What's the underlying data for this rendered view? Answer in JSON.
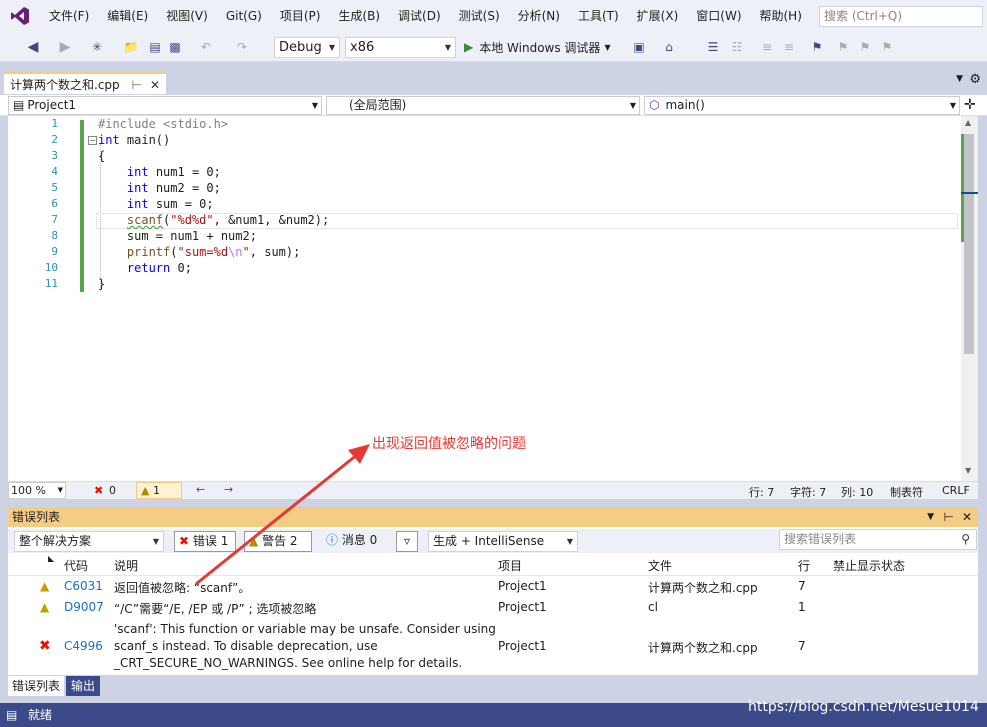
{
  "menu": [
    "文件(F)",
    "编辑(E)",
    "视图(V)",
    "Git(G)",
    "项目(P)",
    "生成(B)",
    "调试(D)",
    "测试(S)",
    "分析(N)",
    "工具(T)",
    "扩展(X)",
    "窗口(W)",
    "帮助(H)"
  ],
  "search": {
    "placeholder": "搜索 (Ctrl+Q)"
  },
  "toolbar": {
    "config": "Debug",
    "platform": "x86",
    "run_label": "本地 Windows 调试器"
  },
  "tab": {
    "title": "计算两个数之和.cpp"
  },
  "nav": {
    "project": "Project1",
    "scope": "(全局范围)",
    "func": "main()"
  },
  "code_lines": [
    "#include <stdio.h>",
    "int main()",
    "{",
    "    int num1 = 0;",
    "    int num2 = 0;",
    "    int sum = 0;",
    "    scanf(\"%d%d\", &num1, &num2);",
    "    sum = num1 + num2;",
    "    printf(\"sum=%d\\n\", sum);",
    "    return 0;",
    "}"
  ],
  "editor_status": {
    "zoom": "100 %",
    "errors": "0",
    "warnings": "1",
    "line": "行: 7",
    "char": "字符: 7",
    "col": "列: 10",
    "tabs": "制表符",
    "eol": "CRLF"
  },
  "error_list": {
    "title": "错误列表",
    "scope": "整个解决方案",
    "errors_btn": "错误 1",
    "warnings_btn": "警告 2",
    "messages_btn": "消息 0",
    "source": "生成 + IntelliSense",
    "search_placeholder": "搜索错误列表",
    "columns": [
      "代码",
      "说明",
      "项目",
      "文件",
      "行",
      "禁止显示状态"
    ],
    "rows": [
      {
        "type": "warning",
        "code": "C6031",
        "desc": [
          "返回值被忽略: “scanf”。"
        ],
        "project": "Project1",
        "file": "计算两个数之和.cpp",
        "line": "7"
      },
      {
        "type": "warning",
        "code": "D9007",
        "desc": [
          "“/C”需要“/E, /EP 或 /P” ; 选项被忽略"
        ],
        "project": "Project1",
        "file": "cl",
        "line": "1"
      },
      {
        "type": "error",
        "code": "C4996",
        "desc": [
          "'scanf': This function or variable may be unsafe. Consider using",
          "scanf_s instead. To disable deprecation, use",
          "_CRT_SECURE_NO_WARNINGS. See online help for details."
        ],
        "project": "Project1",
        "file": "计算两个数之和.cpp",
        "line": "7"
      }
    ]
  },
  "bottom_tabs": [
    "错误列表",
    "输出"
  ],
  "status": {
    "text": "就绪"
  },
  "annotation": "出现返回值被忽略的问题",
  "watermark": "https://blog.csdn.net/Mesue1014",
  "colors": {
    "accent": "#3c4a8a",
    "tab_active": "#f5cc84",
    "annotation": "#e53935",
    "error": "#e51400",
    "warning": "#f2c200"
  }
}
